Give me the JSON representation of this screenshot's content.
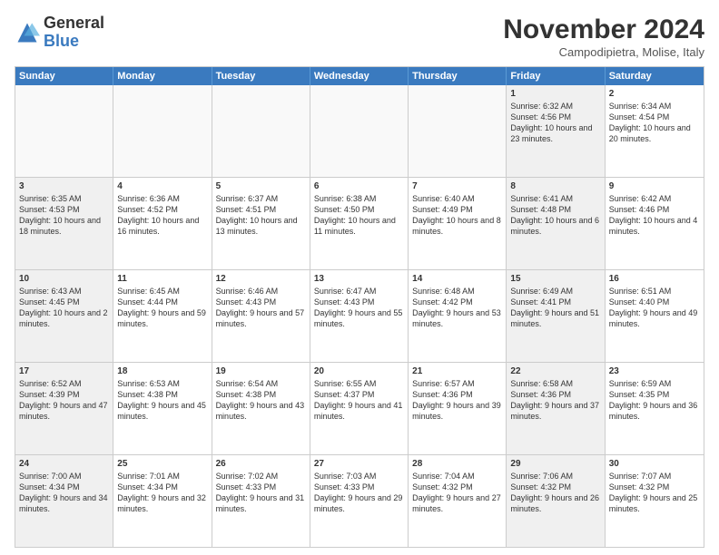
{
  "header": {
    "logo_general": "General",
    "logo_blue": "Blue",
    "month_title": "November 2024",
    "location": "Campodipietra, Molise, Italy"
  },
  "weekdays": [
    "Sunday",
    "Monday",
    "Tuesday",
    "Wednesday",
    "Thursday",
    "Friday",
    "Saturday"
  ],
  "rows": [
    [
      {
        "day": "",
        "text": "",
        "empty": true
      },
      {
        "day": "",
        "text": "",
        "empty": true
      },
      {
        "day": "",
        "text": "",
        "empty": true
      },
      {
        "day": "",
        "text": "",
        "empty": true
      },
      {
        "day": "",
        "text": "",
        "empty": true
      },
      {
        "day": "1",
        "text": "Sunrise: 6:32 AM\nSunset: 4:56 PM\nDaylight: 10 hours and 23 minutes.",
        "shaded": true
      },
      {
        "day": "2",
        "text": "Sunrise: 6:34 AM\nSunset: 4:54 PM\nDaylight: 10 hours and 20 minutes.",
        "shaded": false
      }
    ],
    [
      {
        "day": "3",
        "text": "Sunrise: 6:35 AM\nSunset: 4:53 PM\nDaylight: 10 hours and 18 minutes.",
        "shaded": true
      },
      {
        "day": "4",
        "text": "Sunrise: 6:36 AM\nSunset: 4:52 PM\nDaylight: 10 hours and 16 minutes."
      },
      {
        "day": "5",
        "text": "Sunrise: 6:37 AM\nSunset: 4:51 PM\nDaylight: 10 hours and 13 minutes."
      },
      {
        "day": "6",
        "text": "Sunrise: 6:38 AM\nSunset: 4:50 PM\nDaylight: 10 hours and 11 minutes."
      },
      {
        "day": "7",
        "text": "Sunrise: 6:40 AM\nSunset: 4:49 PM\nDaylight: 10 hours and 8 minutes."
      },
      {
        "day": "8",
        "text": "Sunrise: 6:41 AM\nSunset: 4:48 PM\nDaylight: 10 hours and 6 minutes.",
        "shaded": true
      },
      {
        "day": "9",
        "text": "Sunrise: 6:42 AM\nSunset: 4:46 PM\nDaylight: 10 hours and 4 minutes."
      }
    ],
    [
      {
        "day": "10",
        "text": "Sunrise: 6:43 AM\nSunset: 4:45 PM\nDaylight: 10 hours and 2 minutes.",
        "shaded": true
      },
      {
        "day": "11",
        "text": "Sunrise: 6:45 AM\nSunset: 4:44 PM\nDaylight: 9 hours and 59 minutes."
      },
      {
        "day": "12",
        "text": "Sunrise: 6:46 AM\nSunset: 4:43 PM\nDaylight: 9 hours and 57 minutes."
      },
      {
        "day": "13",
        "text": "Sunrise: 6:47 AM\nSunset: 4:43 PM\nDaylight: 9 hours and 55 minutes."
      },
      {
        "day": "14",
        "text": "Sunrise: 6:48 AM\nSunset: 4:42 PM\nDaylight: 9 hours and 53 minutes."
      },
      {
        "day": "15",
        "text": "Sunrise: 6:49 AM\nSunset: 4:41 PM\nDaylight: 9 hours and 51 minutes.",
        "shaded": true
      },
      {
        "day": "16",
        "text": "Sunrise: 6:51 AM\nSunset: 4:40 PM\nDaylight: 9 hours and 49 minutes."
      }
    ],
    [
      {
        "day": "17",
        "text": "Sunrise: 6:52 AM\nSunset: 4:39 PM\nDaylight: 9 hours and 47 minutes.",
        "shaded": true
      },
      {
        "day": "18",
        "text": "Sunrise: 6:53 AM\nSunset: 4:38 PM\nDaylight: 9 hours and 45 minutes."
      },
      {
        "day": "19",
        "text": "Sunrise: 6:54 AM\nSunset: 4:38 PM\nDaylight: 9 hours and 43 minutes."
      },
      {
        "day": "20",
        "text": "Sunrise: 6:55 AM\nSunset: 4:37 PM\nDaylight: 9 hours and 41 minutes."
      },
      {
        "day": "21",
        "text": "Sunrise: 6:57 AM\nSunset: 4:36 PM\nDaylight: 9 hours and 39 minutes."
      },
      {
        "day": "22",
        "text": "Sunrise: 6:58 AM\nSunset: 4:36 PM\nDaylight: 9 hours and 37 minutes.",
        "shaded": true
      },
      {
        "day": "23",
        "text": "Sunrise: 6:59 AM\nSunset: 4:35 PM\nDaylight: 9 hours and 36 minutes."
      }
    ],
    [
      {
        "day": "24",
        "text": "Sunrise: 7:00 AM\nSunset: 4:34 PM\nDaylight: 9 hours and 34 minutes.",
        "shaded": true
      },
      {
        "day": "25",
        "text": "Sunrise: 7:01 AM\nSunset: 4:34 PM\nDaylight: 9 hours and 32 minutes."
      },
      {
        "day": "26",
        "text": "Sunrise: 7:02 AM\nSunset: 4:33 PM\nDaylight: 9 hours and 31 minutes."
      },
      {
        "day": "27",
        "text": "Sunrise: 7:03 AM\nSunset: 4:33 PM\nDaylight: 9 hours and 29 minutes."
      },
      {
        "day": "28",
        "text": "Sunrise: 7:04 AM\nSunset: 4:32 PM\nDaylight: 9 hours and 27 minutes."
      },
      {
        "day": "29",
        "text": "Sunrise: 7:06 AM\nSunset: 4:32 PM\nDaylight: 9 hours and 26 minutes.",
        "shaded": true
      },
      {
        "day": "30",
        "text": "Sunrise: 7:07 AM\nSunset: 4:32 PM\nDaylight: 9 hours and 25 minutes."
      }
    ]
  ]
}
